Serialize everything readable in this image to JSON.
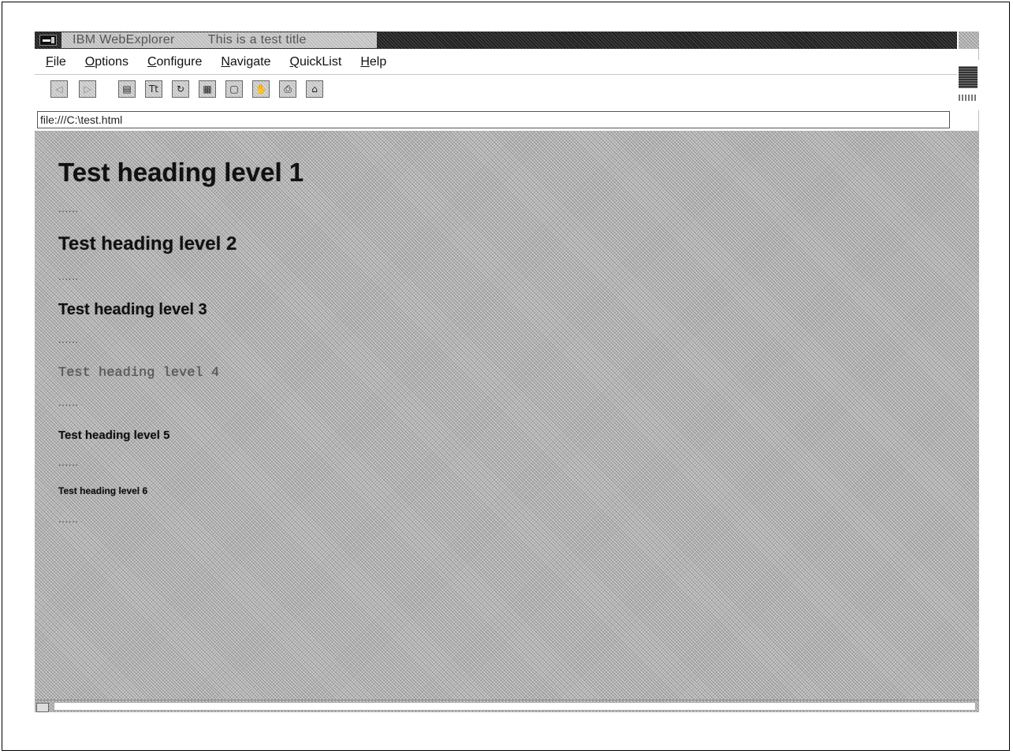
{
  "window": {
    "app_name": "IBM WebExplorer",
    "page_title": "This is a test title"
  },
  "menu": {
    "items": [
      "File",
      "Options",
      "Configure",
      "Navigate",
      "QuickList",
      "Help"
    ]
  },
  "toolbar": {
    "buttons": [
      {
        "icon": "back-icon",
        "glyph": "◁",
        "enabled": false
      },
      {
        "icon": "forward-icon",
        "glyph": "▷",
        "enabled": false
      },
      {
        "icon": "open-document-icon",
        "glyph": "▤"
      },
      {
        "icon": "text-icon",
        "glyph": "Tt"
      },
      {
        "icon": "reload-icon",
        "glyph": "↻"
      },
      {
        "icon": "map-icon",
        "glyph": "▦"
      },
      {
        "icon": "page-icon",
        "glyph": "▢"
      },
      {
        "icon": "stop-icon",
        "glyph": "✋"
      },
      {
        "icon": "print-icon",
        "glyph": "⎙"
      },
      {
        "icon": "home-icon",
        "glyph": "⌂"
      }
    ]
  },
  "address": {
    "url": "file:///C:\\test.html"
  },
  "content": {
    "h1": "Test heading level 1",
    "h2": "Test heading level 2",
    "h3": "Test heading level 3",
    "h4": "Test heading level 4",
    "h5": "Test heading level 5",
    "h6": "Test heading level 6",
    "separator": "......"
  }
}
